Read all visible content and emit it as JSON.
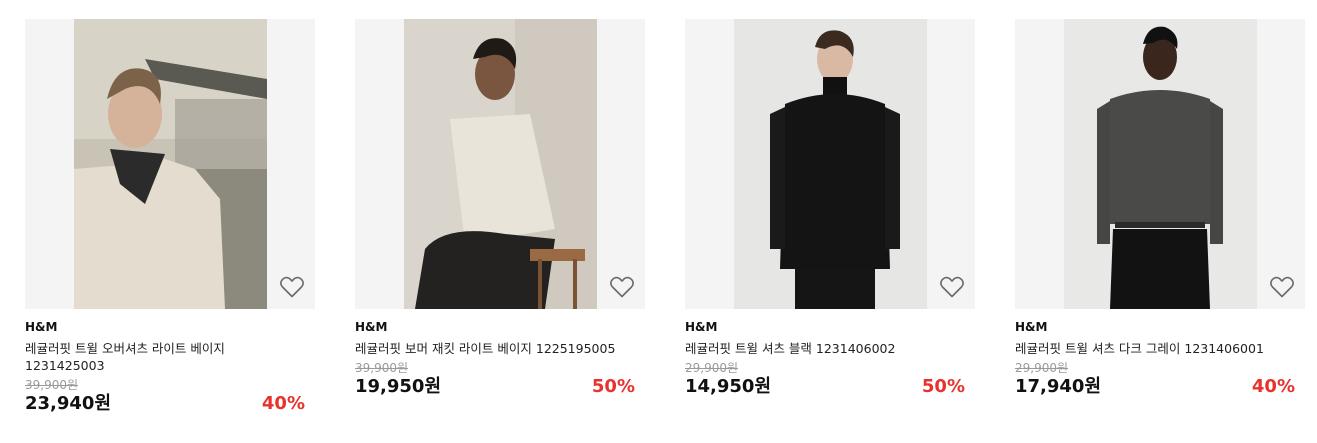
{
  "products": [
    {
      "brand": "H&M",
      "name": "레귤러핏 트윌 오버셔츠 라이트 베이지 1231425003",
      "original_price": "39,900원",
      "price": "23,940원",
      "discount": "40%"
    },
    {
      "brand": "H&M",
      "name": "레귤러핏 보머 재킷 라이트 베이지 1225195005",
      "original_price": "39,900원",
      "price": "19,950원",
      "discount": "50%"
    },
    {
      "brand": "H&M",
      "name": "레귤러핏 트윌 셔츠 블랙 1231406002",
      "original_price": "29,900원",
      "price": "14,950원",
      "discount": "50%"
    },
    {
      "brand": "H&M",
      "name": "레귤러핏 트윌 셔츠 다크 그레이 1231406001",
      "original_price": "29,900원",
      "price": "17,940원",
      "discount": "40%"
    }
  ],
  "icons": {
    "wishlist": "heart-outline-icon"
  },
  "colors": {
    "discount": "#e8322d",
    "original_price": "#9a9a9a",
    "image_bg": "#f4f4f4"
  }
}
